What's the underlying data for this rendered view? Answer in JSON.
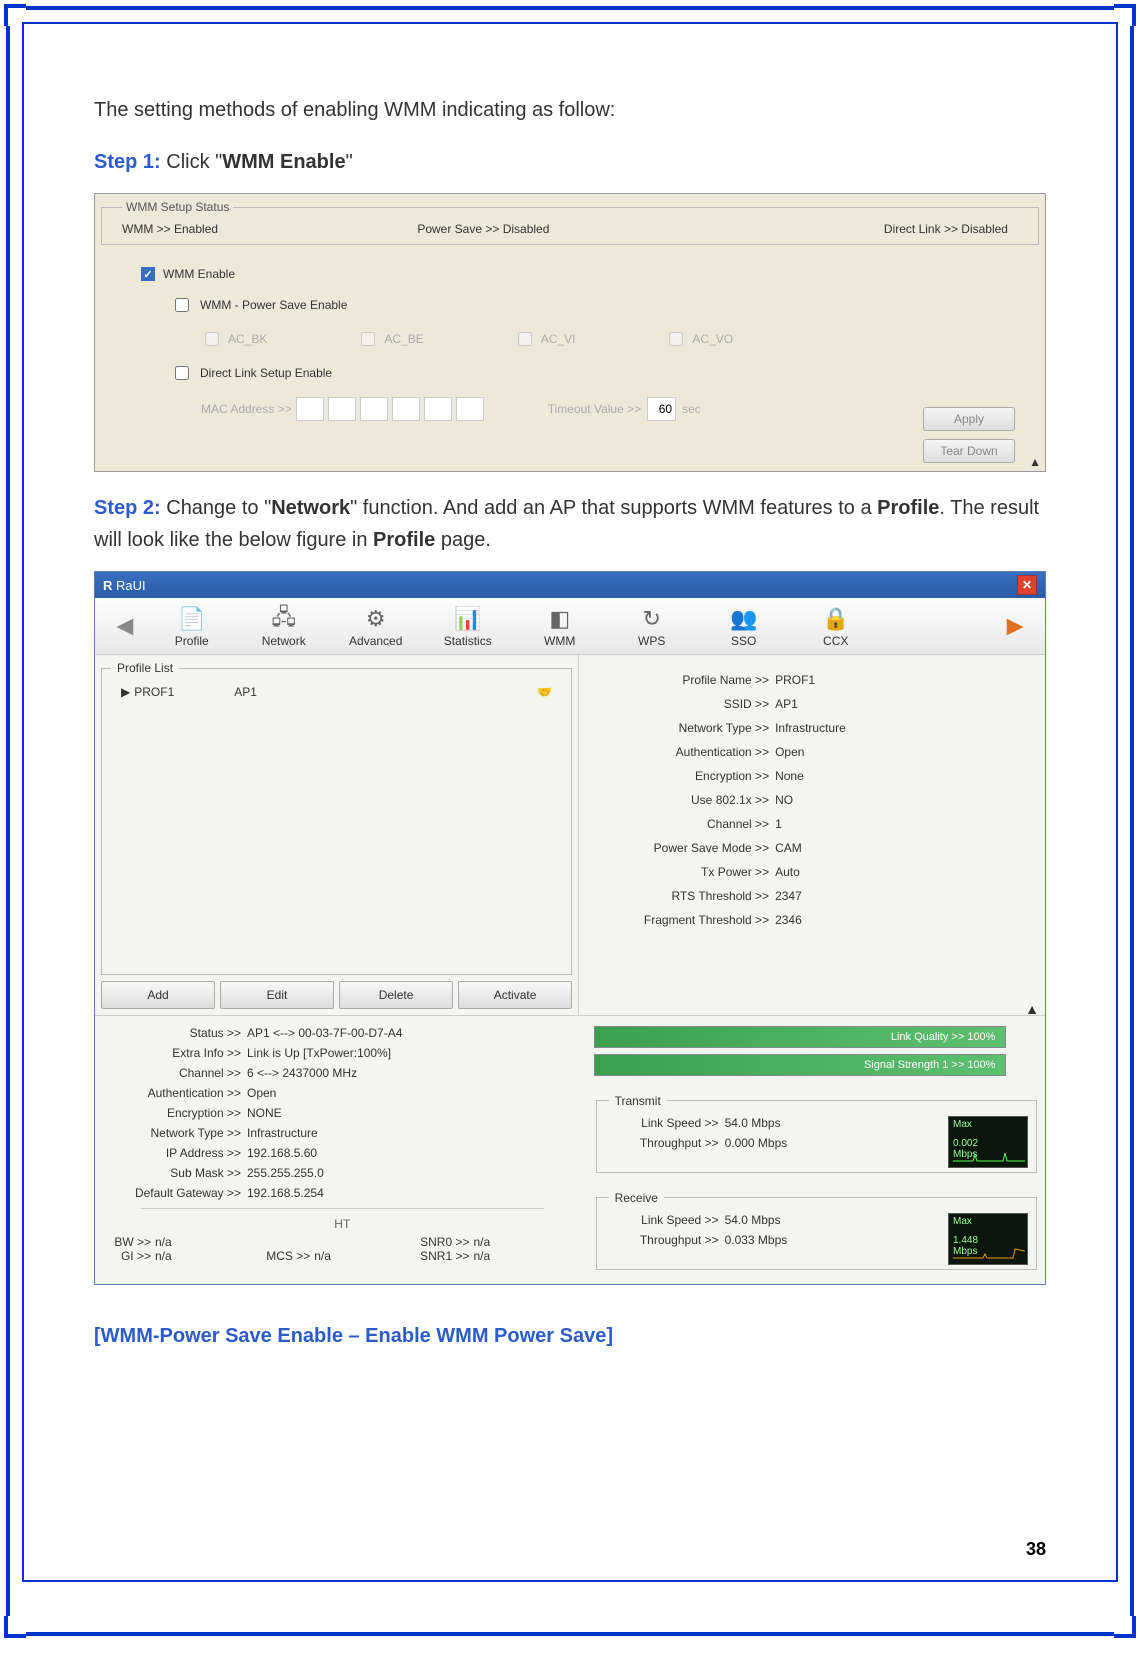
{
  "intro_text": "The setting methods of enabling WMM indicating as follow:",
  "step1": {
    "label": "Step 1:",
    "text_before": " Click \"",
    "bold": "WMM Enable",
    "text_after": "\""
  },
  "step2": {
    "label": "Step 2:",
    "text_before": " Change to \"",
    "bold1": "Network",
    "text_mid": "\" function. And add an AP that supports WMM features to a ",
    "bold2": "Profile",
    "text_mid2": ". The result will look like the below figure in ",
    "bold3": "Profile",
    "text_after": " page."
  },
  "section_title": "[WMM-Power Save Enable – Enable WMM Power Save]",
  "page_number": "38",
  "shot1": {
    "group_title": "WMM Setup Status",
    "status_wmm": "WMM >> Enabled",
    "status_ps": "Power Save >> Disabled",
    "status_dl": "Direct Link >> Disabled",
    "wmm_enable": "WMM Enable",
    "ps_enable": "WMM - Power Save Enable",
    "ac": [
      "AC_BK",
      "AC_BE",
      "AC_VI",
      "AC_VO"
    ],
    "dl_enable": "Direct Link Setup Enable",
    "mac_label": "MAC Address >>",
    "timeout_label": "Timeout Value >>",
    "timeout_value": "60",
    "timeout_unit": "sec",
    "btn_apply": "Apply",
    "btn_tear": "Tear Down"
  },
  "shot2": {
    "title": "RaUI",
    "toolbar": [
      "Profile",
      "Network",
      "Advanced",
      "Statistics",
      "WMM",
      "WPS",
      "SSO",
      "CCX"
    ],
    "profile_list_title": "Profile List",
    "profile_name": "PROF1",
    "profile_ssid": "AP1",
    "prof_buttons": [
      "Add",
      "Edit",
      "Delete",
      "Activate"
    ],
    "details": [
      [
        "Profile Name >>",
        "PROF1"
      ],
      [
        "SSID >>",
        "AP1"
      ],
      [
        "Network Type >>",
        "Infrastructure"
      ],
      [
        "Authentication >>",
        "Open"
      ],
      [
        "Encryption >>",
        "None"
      ],
      [
        "Use 802.1x >>",
        "NO"
      ],
      [
        "Channel >>",
        "1"
      ],
      [
        "Power Save Mode >>",
        "CAM"
      ],
      [
        "Tx Power >>",
        "Auto"
      ],
      [
        "RTS Threshold >>",
        "2347"
      ],
      [
        "Fragment Threshold >>",
        "2346"
      ]
    ],
    "status_rows": [
      [
        "Status >>",
        "AP1 <--> 00-03-7F-00-D7-A4"
      ],
      [
        "Extra Info >>",
        "Link is Up [TxPower:100%]"
      ],
      [
        "Channel >>",
        "6 <--> 2437000 MHz"
      ],
      [
        "Authentication >>",
        "Open"
      ],
      [
        "Encryption >>",
        "NONE"
      ],
      [
        "Network Type >>",
        "Infrastructure"
      ],
      [
        "IP Address >>",
        "192.168.5.60"
      ],
      [
        "Sub Mask >>",
        "255.255.255.0"
      ],
      [
        "Default Gateway >>",
        "192.168.5.254"
      ]
    ],
    "ht_label": "HT",
    "ht": [
      [
        "BW >>",
        "n/a"
      ],
      [
        "SNR0 >>",
        "n/a"
      ],
      [
        "GI >>",
        "n/a"
      ],
      [
        "MCS >>",
        "n/a"
      ],
      [
        "SNR1 >>",
        "n/a"
      ]
    ],
    "bar_link": "Link Quality >> 100%",
    "bar_signal": "Signal Strength 1 >> 100%",
    "transmit_title": "Transmit",
    "receive_title": "Receive",
    "tx": [
      [
        "Link Speed >>",
        "54.0 Mbps"
      ],
      [
        "Throughput >>",
        "0.000 Mbps"
      ]
    ],
    "rx": [
      [
        "Link Speed >>",
        "54.0 Mbps"
      ],
      [
        "Throughput >>",
        "0.033 Mbps"
      ]
    ],
    "tx_graph": {
      "top": "Max",
      "mid": "0.002",
      "bot": "Mbps"
    },
    "rx_graph": {
      "top": "Max",
      "mid": "1.448",
      "bot": "Mbps"
    }
  }
}
